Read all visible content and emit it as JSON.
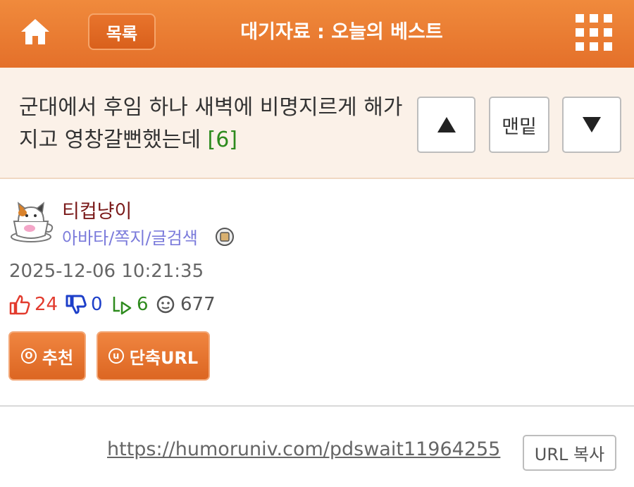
{
  "header": {
    "home_icon": "home-icon",
    "list_label": "목록",
    "title": "대기자료 : 오늘의 베스트",
    "menu_icon": "grid-menu-icon"
  },
  "post": {
    "title": "군대에서 후임 하나 새벽에 비명지르게 해가지고 영창갈뻔했는데",
    "comment_count": "[6]",
    "nav": {
      "up_icon": "triangle-up-icon",
      "bottom_label": "맨밑",
      "down_icon": "triangle-down-icon"
    }
  },
  "author": {
    "name": "티컵냥이",
    "link_avatar": "아바타",
    "link_message": "쪽지",
    "link_textcolor": "글검색",
    "separator": "/",
    "date": "2025-12-06 10:21:35"
  },
  "stats": {
    "upvotes": "24",
    "downvotes": "0",
    "replies": "6",
    "views": "677"
  },
  "actions": {
    "recommend_label": "추천",
    "recommend_symbol": "O",
    "shorturl_label": "단축URL",
    "shorturl_symbol": "u"
  },
  "url": {
    "text": "https://humoruniv.com/pdswait11964255",
    "copy_label": "URL 복사"
  },
  "colors": {
    "header": "#e4702a",
    "title_bg": "#fbf1e8",
    "upvote": "#e23b2e",
    "downvote": "#1d3fc9",
    "reply": "#2e8b1e",
    "author_name": "#7a1a1a",
    "author_links": "#7b7bdb"
  }
}
